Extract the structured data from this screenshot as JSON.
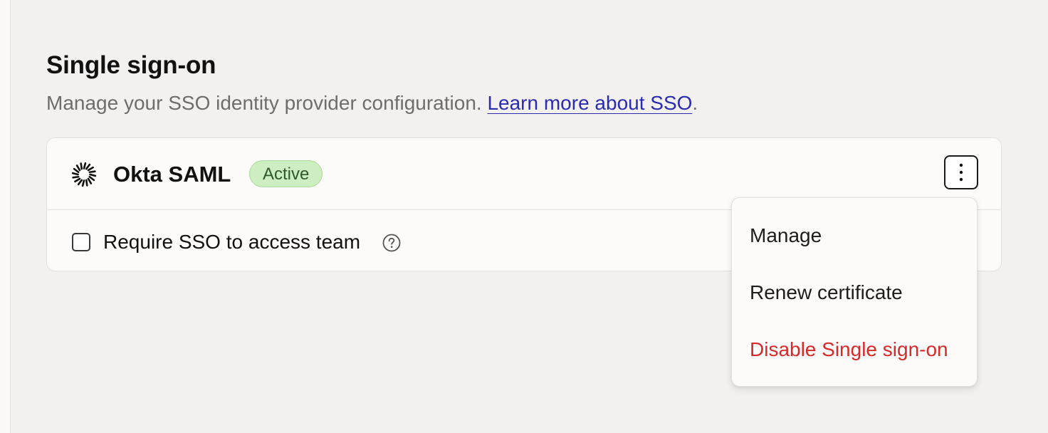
{
  "section": {
    "title": "Single sign-on",
    "description": "Manage your SSO identity provider configuration. ",
    "learn_more_link": "Learn more about SSO",
    "description_end": "."
  },
  "provider": {
    "name": "Okta SAML",
    "status": "Active",
    "logo_icon": "okta-sunburst-icon",
    "menu_icon": "more-vertical-icon"
  },
  "require_sso": {
    "label": "Require SSO to access team",
    "checked": false,
    "help_icon": "question-circle-icon"
  },
  "menu": {
    "items": [
      {
        "label": "Manage"
      },
      {
        "label": "Renew certificate"
      },
      {
        "label": "Disable Single sign-on"
      }
    ]
  },
  "colors": {
    "link": "#2b2bb0",
    "badge_bg": "#cdeec1",
    "badge_text": "#2f5a26",
    "danger": "#d42a2a"
  }
}
